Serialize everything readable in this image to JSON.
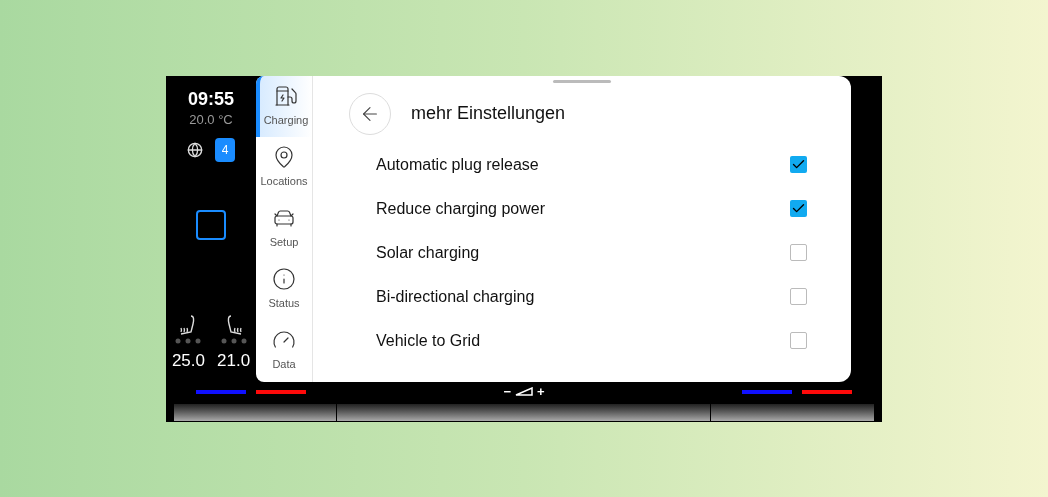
{
  "status": {
    "time": "09:55",
    "outside_temp": "20.0 °C",
    "badge": "4"
  },
  "climate": [
    {
      "temp": "25.0"
    },
    {
      "temp": "21.0"
    }
  ],
  "sidebar": {
    "items": [
      {
        "kind": "charging",
        "label": "Charging",
        "selected": true
      },
      {
        "kind": "locations",
        "label": "Locations",
        "selected": false
      },
      {
        "kind": "setup",
        "label": "Setup",
        "selected": false
      },
      {
        "kind": "status",
        "label": "Status",
        "selected": false
      },
      {
        "kind": "data",
        "label": "Data",
        "selected": false
      }
    ]
  },
  "panel": {
    "title": "mehr Einstellungen",
    "settings": [
      {
        "label": "Automatic plug release",
        "checked": true
      },
      {
        "label": "Reduce charging power",
        "checked": true
      },
      {
        "label": "Solar charging",
        "checked": false
      },
      {
        "label": "Bi-directional charging",
        "checked": false
      },
      {
        "label": "Vehicle to Grid",
        "checked": false
      }
    ]
  },
  "volume": {
    "minus": "−",
    "plus": "+"
  }
}
